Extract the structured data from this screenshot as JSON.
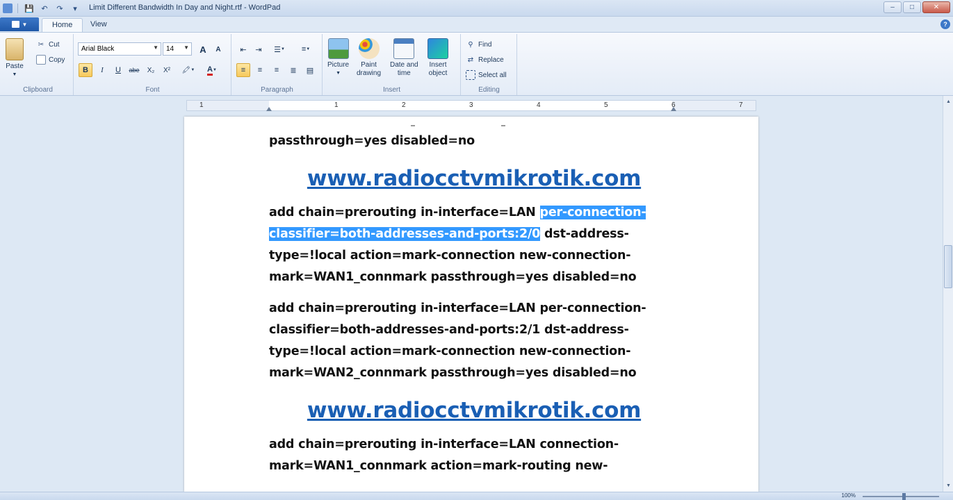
{
  "window": {
    "title": "Limit Different Bandwidth In Day and Night.rtf - WordPad",
    "minimize": "–",
    "maximize": "□",
    "close": "✕"
  },
  "qat": {
    "save": "💾",
    "undo": "↶",
    "redo": "↷",
    "customize": "▾"
  },
  "tabs": [
    {
      "label": "Home"
    },
    {
      "label": "View"
    }
  ],
  "help": "?",
  "ribbon": {
    "clipboard": {
      "label": "Clipboard",
      "paste": "Paste",
      "cut": "Cut",
      "copy": "Copy"
    },
    "font": {
      "label": "Font",
      "family": "Arial Black",
      "size": "14",
      "grow": "A",
      "shrink": "A",
      "bold": "B",
      "italic": "I",
      "underline": "U",
      "strike": "abe",
      "subscript": "X₂",
      "superscript": "X²",
      "highlight": "🖍",
      "color": "A"
    },
    "paragraph": {
      "label": "Paragraph"
    },
    "insert": {
      "label": "Insert",
      "picture": "Picture",
      "paint1": "Paint",
      "paint2": "drawing",
      "date1": "Date and",
      "date2": "time",
      "object1": "Insert",
      "object2": "object"
    },
    "editing": {
      "label": "Editing",
      "find": "Find",
      "replace": "Replace",
      "select_all": "Select all"
    }
  },
  "ruler": {
    "numbers": [
      "1",
      "1",
      "2",
      "3",
      "4",
      "5",
      "6",
      "7"
    ]
  },
  "document": {
    "line0": "passthrough=yes disabled=no",
    "link1": "www.radiocctvmikrotik.com",
    "p1_pre": "add chain=prerouting in-interface=LAN ",
    "p1_sel1": "per-connection-",
    "p1_sel2": "classifier=both-addresses-and-ports:2/0",
    "p1_post": " dst-address-type=!local action=mark-connection new-connection-mark=WAN1_connmark passthrough=yes disabled=no",
    "p2": "add chain=prerouting in-interface=LAN per-connection-classifier=both-addresses-and-ports:2/1 dst-address-type=!local action=mark-connection new-connection-mark=WAN2_connmark passthrough=yes disabled=no",
    "link2": "www.radiocctvmikrotik.com",
    "p3": "add chain=prerouting in-interface=LAN connection-mark=WAN1_connmark action=mark-routing new-"
  },
  "status": {
    "zoom": "100%"
  }
}
